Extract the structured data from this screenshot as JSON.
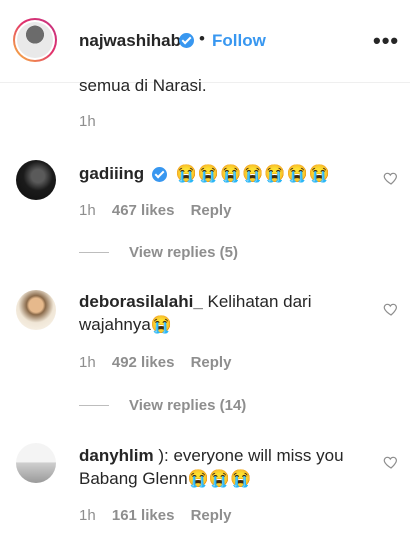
{
  "header": {
    "username": "najwashihab",
    "separator": "•",
    "follow_label": "Follow",
    "more_label": "•••",
    "verified_icon": "verified-badge-icon",
    "accent": "#3897f0"
  },
  "top_comment": {
    "clipped_text": "semua di Narasi.",
    "time": "1h"
  },
  "comments": [
    {
      "username": "gadiiing",
      "text": "😭😭😭😭😭😭😭",
      "time": "1h",
      "likes": "467 likes",
      "reply_label": "Reply",
      "view_replies": "View replies (5)"
    },
    {
      "username": "deborasilalahi_",
      "text": "Kelihatan dari wajahnya😭",
      "time": "1h",
      "likes": "492 likes",
      "reply_label": "Reply",
      "view_replies": "View replies (14)"
    },
    {
      "username": "danyhlim",
      "text": "): everyone will miss you Babang Glenn😭😭😭",
      "time": "1h",
      "likes": "161 likes",
      "reply_label": "Reply"
    }
  ]
}
